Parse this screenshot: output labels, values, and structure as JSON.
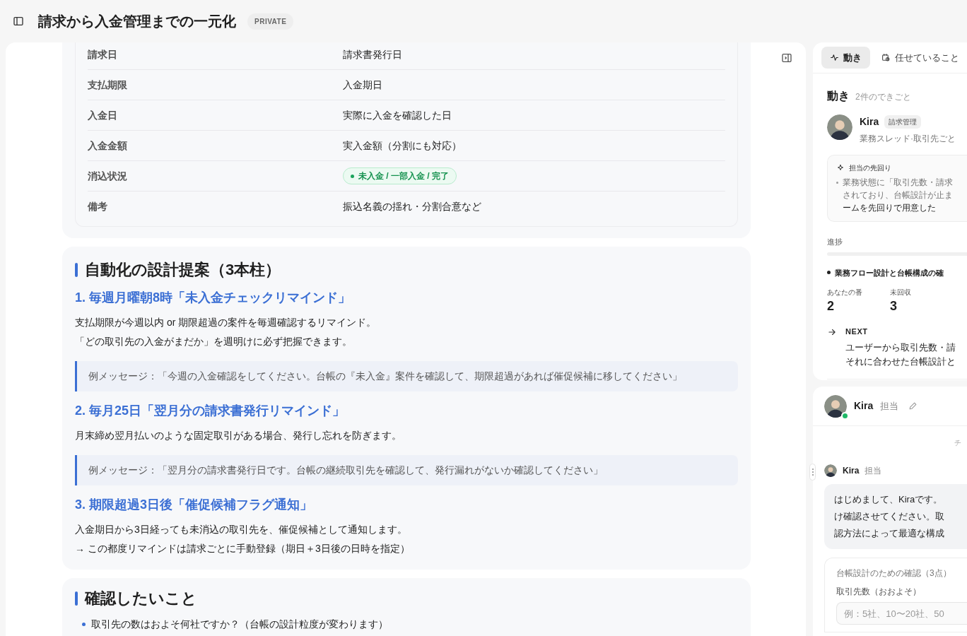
{
  "header": {
    "title": "請求から入金管理までの一元化",
    "badge": "PRIVATE"
  },
  "table": {
    "rows": [
      {
        "label": "請求日",
        "value": "請求書発行日",
        "kind": "text"
      },
      {
        "label": "支払期限",
        "value": "入金期日",
        "kind": "text"
      },
      {
        "label": "入金日",
        "value": "実際に入金を確認した日",
        "kind": "text"
      },
      {
        "label": "入金金額",
        "value": "実入金額（分割にも対応）",
        "kind": "text"
      },
      {
        "label": "消込状況",
        "value": "未入金 / 一部入金 / 完了",
        "kind": "status"
      },
      {
        "label": "備考",
        "value": "振込名義の揺れ・分割合意など",
        "kind": "text"
      }
    ]
  },
  "proposal": {
    "heading": "自動化の設計提案（3本柱）",
    "items": [
      {
        "title": "1. 毎週月曜朝8時「未入金チェックリマインド」",
        "lines": [
          "支払期限が今週以内 or 期限超過の案件を毎週確認するリマインド。",
          "「どの取引先の入金がまだか」を週明けに必ず把握できます。"
        ],
        "example": "例メッセージ：「今週の入金確認をしてください。台帳の『未入金』案件を確認して、期限超過があれば催促候補に移してください」"
      },
      {
        "title": "2. 毎月25日「翌月分の請求書発行リマインド」",
        "lines": [
          "月末締め翌月払いのような固定取引がある場合、発行し忘れを防ぎます。"
        ],
        "example": "例メッセージ：「翌月分の請求書発行日です。台帳の継続取引先を確認して、発行漏れがないか確認してください」"
      },
      {
        "title": "3. 期限超過3日後「催促候補フラグ通知」",
        "lines": [
          "入金期日から3日経っても未消込の取引先を、催促候補として通知します。",
          "→ この都度リマインドは請求ごとに手動登録（期日＋3日後の日時を指定）"
        ]
      }
    ]
  },
  "questions": {
    "heading": "確認したいこと",
    "bullets": [
      "取引先の数はおよそ何社ですか？（台帳の設計粒度が変わります）"
    ]
  },
  "activity": {
    "tabs": [
      {
        "label": "動き",
        "selected": true
      },
      {
        "label": "任せていること",
        "selected": false
      }
    ],
    "title": "動き",
    "count": "2件のできごと",
    "event": {
      "name": "Kira",
      "tag": "請求管理",
      "subtitle": "業務スレッド·取引先ごと"
    },
    "proactive": {
      "title": "担当の先回り",
      "bullets": [
        "業務状態に「取引先数・請求",
        "されており、台帳設計が止ま",
        "ームを先回りで用意した"
      ]
    },
    "progress": {
      "label": "進捗",
      "level": 0
    },
    "stage": "業務フロー設計と台帳構成の確",
    "stats": [
      {
        "label": "あなたの番",
        "value": "2"
      },
      {
        "label": "未回収",
        "value": "3"
      }
    ],
    "next": {
      "label": "NEXT",
      "lines": [
        "ユーザーから取引先数・請",
        "それに合わせた台帳設計と"
      ]
    }
  },
  "chat": {
    "header": {
      "name": "Kira",
      "role": "担当",
      "online": true
    },
    "divider": "チ",
    "message": {
      "name": "Kira",
      "role": "担当",
      "lines": [
        "はじめまして、Kiraです。",
        "け確認させてください。取",
        "認方法によって最適な構成"
      ]
    },
    "form": {
      "title": "台帳設計のための確認（3点）",
      "field_label": "取引先数（おおよそ）",
      "placeholder": "例：5社、10〜20社、50"
    }
  }
}
